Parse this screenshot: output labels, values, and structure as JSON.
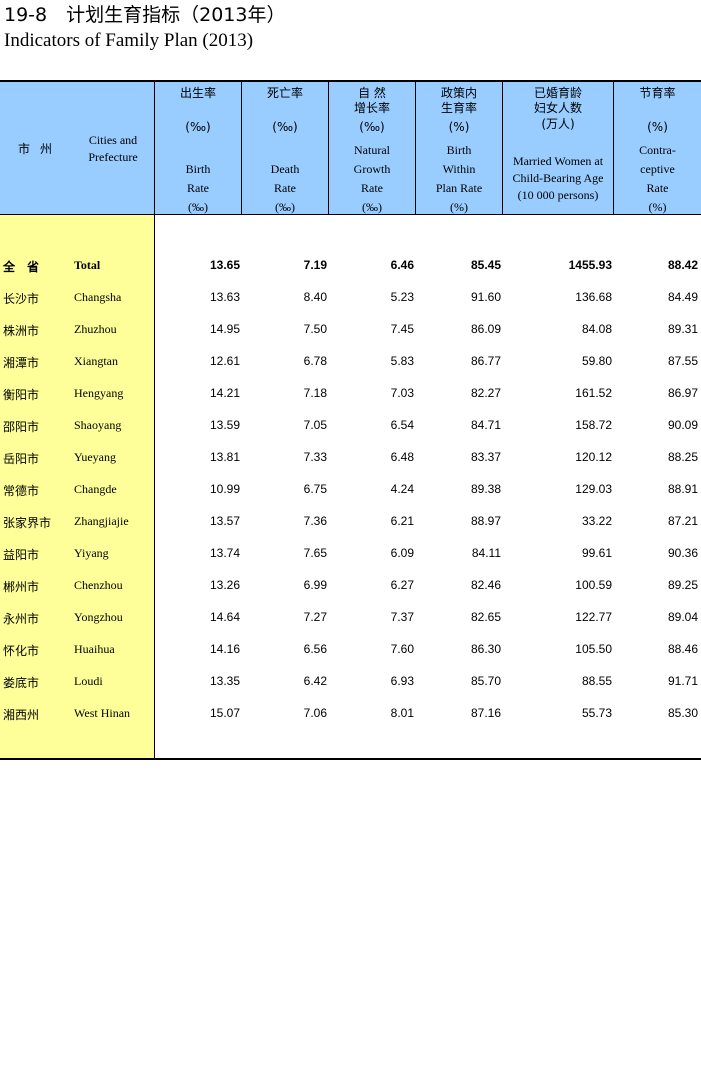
{
  "title": {
    "cn": "19-8　计划生育指标（2013年）",
    "en": "Indicators of Family Plan (2013)"
  },
  "header": {
    "stub_cn": "市州",
    "stub_en_1": "Cities and",
    "stub_en_2": "Prefecture",
    "columns": [
      {
        "cn1": "出生率",
        "cn2": "",
        "unit_cn": "(‰)",
        "en1": "",
        "en2": "Birth",
        "en3": "Rate",
        "unit_en": "(‰)"
      },
      {
        "cn1": "死亡率",
        "cn2": "",
        "unit_cn": "(‰)",
        "en1": "",
        "en2": "Death",
        "en3": "Rate",
        "unit_en": "(‰)"
      },
      {
        "cn1": "自  然",
        "cn2": "增长率",
        "unit_cn": "(‰)",
        "en1": "Natural",
        "en2": "Growth",
        "en3": "Rate",
        "unit_en": "(‰)"
      },
      {
        "cn1": "政策内",
        "cn2": "生育率",
        "unit_cn": "(%)",
        "en1": "Birth",
        "en2": "Within",
        "en3": "Plan Rate",
        "unit_en": "(%)"
      },
      {
        "cn1": "已婚育龄",
        "cn2": "妇女人数",
        "unit_cn": "(万人)",
        "en1": "Married Women at",
        "en2": "Child-Bearing Age",
        "en3": "(10 000 persons)",
        "unit_en": ""
      },
      {
        "cn1": "节育率",
        "cn2": "",
        "unit_cn": "(%)",
        "en1": "Contra-",
        "en2": "ceptive",
        "en3": "Rate",
        "unit_en": "(%)"
      }
    ]
  },
  "rows": [
    {
      "cn": "全　省",
      "en": "Total",
      "v": [
        "13.65",
        "7.19",
        "6.46",
        "85.45",
        "1455.93",
        "88.42"
      ]
    },
    {
      "cn": "长沙市",
      "en": "Changsha",
      "v": [
        "13.63",
        "8.40",
        "5.23",
        "91.60",
        "136.68",
        "84.49"
      ]
    },
    {
      "cn": "株洲市",
      "en": "Zhuzhou",
      "v": [
        "14.95",
        "7.50",
        "7.45",
        "86.09",
        "84.08",
        "89.31"
      ]
    },
    {
      "cn": "湘潭市",
      "en": "Xiangtan",
      "v": [
        "12.61",
        "6.78",
        "5.83",
        "86.77",
        "59.80",
        "87.55"
      ]
    },
    {
      "cn": "衡阳市",
      "en": "Hengyang",
      "v": [
        "14.21",
        "7.18",
        "7.03",
        "82.27",
        "161.52",
        "86.97"
      ]
    },
    {
      "cn": "邵阳市",
      "en": "Shaoyang",
      "v": [
        "13.59",
        "7.05",
        "6.54",
        "84.71",
        "158.72",
        "90.09"
      ]
    },
    {
      "cn": "岳阳市",
      "en": "Yueyang",
      "v": [
        "13.81",
        "7.33",
        "6.48",
        "83.37",
        "120.12",
        "88.25"
      ]
    },
    {
      "cn": "常德市",
      "en": "Changde",
      "v": [
        "10.99",
        "6.75",
        "4.24",
        "89.38",
        "129.03",
        "88.91"
      ]
    },
    {
      "cn": "张家界市",
      "en": "Zhangjiajie",
      "v": [
        "13.57",
        "7.36",
        "6.21",
        "88.97",
        "33.22",
        "87.21"
      ]
    },
    {
      "cn": "益阳市",
      "en": "Yiyang",
      "v": [
        "13.74",
        "7.65",
        "6.09",
        "84.11",
        "99.61",
        "90.36"
      ]
    },
    {
      "cn": "郴州市",
      "en": "Chenzhou",
      "v": [
        "13.26",
        "6.99",
        "6.27",
        "82.46",
        "100.59",
        "89.25"
      ]
    },
    {
      "cn": "永州市",
      "en": "Yongzhou",
      "v": [
        "14.64",
        "7.27",
        "7.37",
        "82.65",
        "122.77",
        "89.04"
      ]
    },
    {
      "cn": "怀化市",
      "en": "Huaihua",
      "v": [
        "14.16",
        "6.56",
        "7.60",
        "86.30",
        "105.50",
        "88.46"
      ]
    },
    {
      "cn": "娄底市",
      "en": "Loudi",
      "v": [
        "13.35",
        "6.42",
        "6.93",
        "85.70",
        "88.55",
        "91.71"
      ]
    },
    {
      "cn": "湘西州",
      "en": "West Hinan",
      "v": [
        "15.07",
        "7.06",
        "8.01",
        "87.16",
        "55.73",
        "85.30"
      ]
    }
  ]
}
